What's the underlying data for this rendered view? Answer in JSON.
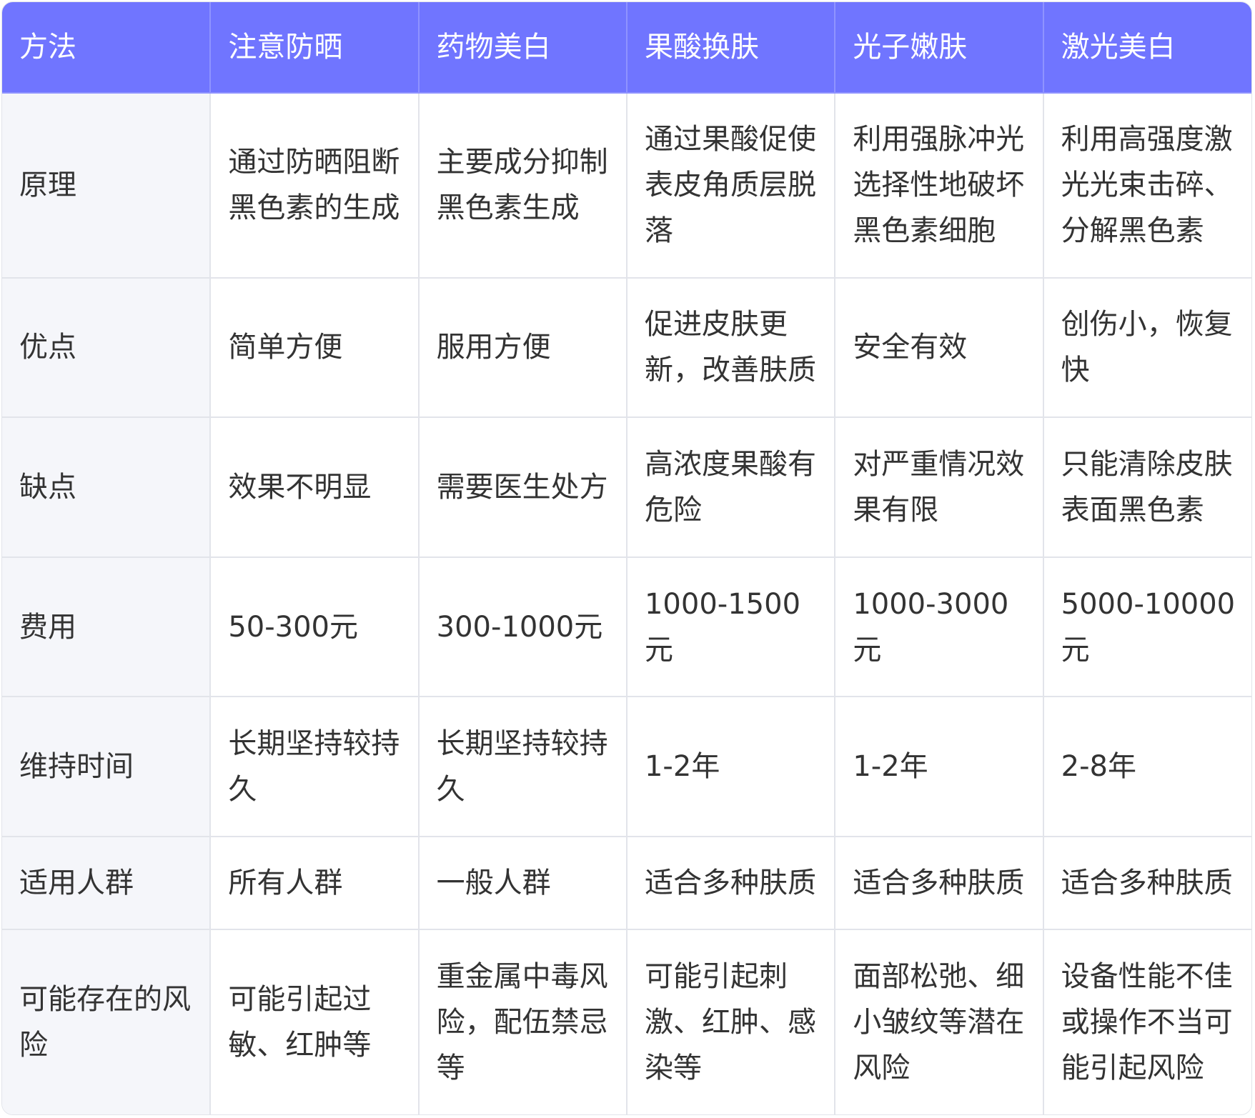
{
  "table": {
    "headers": [
      "方法",
      "注意防晒",
      "药物美白",
      "果酸换肤",
      "光子嫩肤",
      "激光美白"
    ],
    "rows": [
      {
        "label": "原理",
        "cells": [
          "通过防晒阻断黑色素的生成",
          "主要成分抑制黑色素生成",
          "通过果酸促使表皮角质层脱落",
          "利用强脉冲光选择性地破坏黑色素细胞",
          "利用高强度激光光束击碎、分解黑色素"
        ]
      },
      {
        "label": "优点",
        "cells": [
          "简单方便",
          "服用方便",
          "促进皮肤更新，改善肤质",
          "安全有效",
          "创伤小，恢复快"
        ]
      },
      {
        "label": "缺点",
        "cells": [
          "效果不明显",
          "需要医生处方",
          "高浓度果酸有危险",
          "对严重情况效果有限",
          "只能清除皮肤表面黑色素"
        ]
      },
      {
        "label": "费用",
        "cells": [
          "50-300元",
          "300-1000元",
          "1000-1500元",
          "1000-3000元",
          "5000-10000元"
        ]
      },
      {
        "label": "维持时间",
        "cells": [
          "长期坚持较持久",
          "长期坚持较持久",
          "1-2年",
          "1-2年",
          "2-8年"
        ]
      },
      {
        "label": "适用人群",
        "cells": [
          "所有人群",
          "一般人群",
          "适合多种肤质",
          "适合多种肤质",
          "适合多种肤质"
        ]
      },
      {
        "label": "可能存在的风险",
        "cells": [
          "可能引起过敏、红肿等",
          "重金属中毒风险，配伍禁忌等",
          "可能引起刺激、红肿、感染等",
          "面部松弛、细小皱纹等潜在风险",
          "设备性能不佳或操作不当可能引起风险"
        ]
      }
    ]
  },
  "colors": {
    "header_bg": "#7075ff",
    "header_text": "#ffffff",
    "first_col_bg": "#f5f6fa",
    "border": "#e2e4ea",
    "text": "#333333"
  }
}
